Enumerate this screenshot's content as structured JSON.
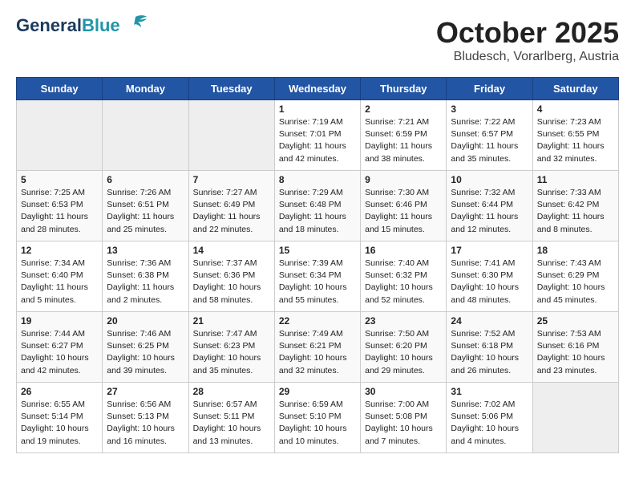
{
  "header": {
    "logo_line1": "General",
    "logo_line2": "Blue",
    "month": "October 2025",
    "location": "Bludesch, Vorarlberg, Austria"
  },
  "days_of_week": [
    "Sunday",
    "Monday",
    "Tuesday",
    "Wednesday",
    "Thursday",
    "Friday",
    "Saturday"
  ],
  "weeks": [
    [
      {
        "day": "",
        "empty": true
      },
      {
        "day": "",
        "empty": true
      },
      {
        "day": "",
        "empty": true
      },
      {
        "day": "1",
        "sunrise": "7:19 AM",
        "sunset": "7:01 PM",
        "daylight": "11 hours and 42 minutes."
      },
      {
        "day": "2",
        "sunrise": "7:21 AM",
        "sunset": "6:59 PM",
        "daylight": "11 hours and 38 minutes."
      },
      {
        "day": "3",
        "sunrise": "7:22 AM",
        "sunset": "6:57 PM",
        "daylight": "11 hours and 35 minutes."
      },
      {
        "day": "4",
        "sunrise": "7:23 AM",
        "sunset": "6:55 PM",
        "daylight": "11 hours and 32 minutes."
      }
    ],
    [
      {
        "day": "5",
        "sunrise": "7:25 AM",
        "sunset": "6:53 PM",
        "daylight": "11 hours and 28 minutes."
      },
      {
        "day": "6",
        "sunrise": "7:26 AM",
        "sunset": "6:51 PM",
        "daylight": "11 hours and 25 minutes."
      },
      {
        "day": "7",
        "sunrise": "7:27 AM",
        "sunset": "6:49 PM",
        "daylight": "11 hours and 22 minutes."
      },
      {
        "day": "8",
        "sunrise": "7:29 AM",
        "sunset": "6:48 PM",
        "daylight": "11 hours and 18 minutes."
      },
      {
        "day": "9",
        "sunrise": "7:30 AM",
        "sunset": "6:46 PM",
        "daylight": "11 hours and 15 minutes."
      },
      {
        "day": "10",
        "sunrise": "7:32 AM",
        "sunset": "6:44 PM",
        "daylight": "11 hours and 12 minutes."
      },
      {
        "day": "11",
        "sunrise": "7:33 AM",
        "sunset": "6:42 PM",
        "daylight": "11 hours and 8 minutes."
      }
    ],
    [
      {
        "day": "12",
        "sunrise": "7:34 AM",
        "sunset": "6:40 PM",
        "daylight": "11 hours and 5 minutes."
      },
      {
        "day": "13",
        "sunrise": "7:36 AM",
        "sunset": "6:38 PM",
        "daylight": "11 hours and 2 minutes."
      },
      {
        "day": "14",
        "sunrise": "7:37 AM",
        "sunset": "6:36 PM",
        "daylight": "10 hours and 58 minutes."
      },
      {
        "day": "15",
        "sunrise": "7:39 AM",
        "sunset": "6:34 PM",
        "daylight": "10 hours and 55 minutes."
      },
      {
        "day": "16",
        "sunrise": "7:40 AM",
        "sunset": "6:32 PM",
        "daylight": "10 hours and 52 minutes."
      },
      {
        "day": "17",
        "sunrise": "7:41 AM",
        "sunset": "6:30 PM",
        "daylight": "10 hours and 48 minutes."
      },
      {
        "day": "18",
        "sunrise": "7:43 AM",
        "sunset": "6:29 PM",
        "daylight": "10 hours and 45 minutes."
      }
    ],
    [
      {
        "day": "19",
        "sunrise": "7:44 AM",
        "sunset": "6:27 PM",
        "daylight": "10 hours and 42 minutes."
      },
      {
        "day": "20",
        "sunrise": "7:46 AM",
        "sunset": "6:25 PM",
        "daylight": "10 hours and 39 minutes."
      },
      {
        "day": "21",
        "sunrise": "7:47 AM",
        "sunset": "6:23 PM",
        "daylight": "10 hours and 35 minutes."
      },
      {
        "day": "22",
        "sunrise": "7:49 AM",
        "sunset": "6:21 PM",
        "daylight": "10 hours and 32 minutes."
      },
      {
        "day": "23",
        "sunrise": "7:50 AM",
        "sunset": "6:20 PM",
        "daylight": "10 hours and 29 minutes."
      },
      {
        "day": "24",
        "sunrise": "7:52 AM",
        "sunset": "6:18 PM",
        "daylight": "10 hours and 26 minutes."
      },
      {
        "day": "25",
        "sunrise": "7:53 AM",
        "sunset": "6:16 PM",
        "daylight": "10 hours and 23 minutes."
      }
    ],
    [
      {
        "day": "26",
        "sunrise": "6:55 AM",
        "sunset": "5:14 PM",
        "daylight": "10 hours and 19 minutes."
      },
      {
        "day": "27",
        "sunrise": "6:56 AM",
        "sunset": "5:13 PM",
        "daylight": "10 hours and 16 minutes."
      },
      {
        "day": "28",
        "sunrise": "6:57 AM",
        "sunset": "5:11 PM",
        "daylight": "10 hours and 13 minutes."
      },
      {
        "day": "29",
        "sunrise": "6:59 AM",
        "sunset": "5:10 PM",
        "daylight": "10 hours and 10 minutes."
      },
      {
        "day": "30",
        "sunrise": "7:00 AM",
        "sunset": "5:08 PM",
        "daylight": "10 hours and 7 minutes."
      },
      {
        "day": "31",
        "sunrise": "7:02 AM",
        "sunset": "5:06 PM",
        "daylight": "10 hours and 4 minutes."
      },
      {
        "day": "",
        "empty": true
      }
    ]
  ],
  "labels": {
    "sunrise": "Sunrise:",
    "sunset": "Sunset:",
    "daylight": "Daylight:"
  }
}
